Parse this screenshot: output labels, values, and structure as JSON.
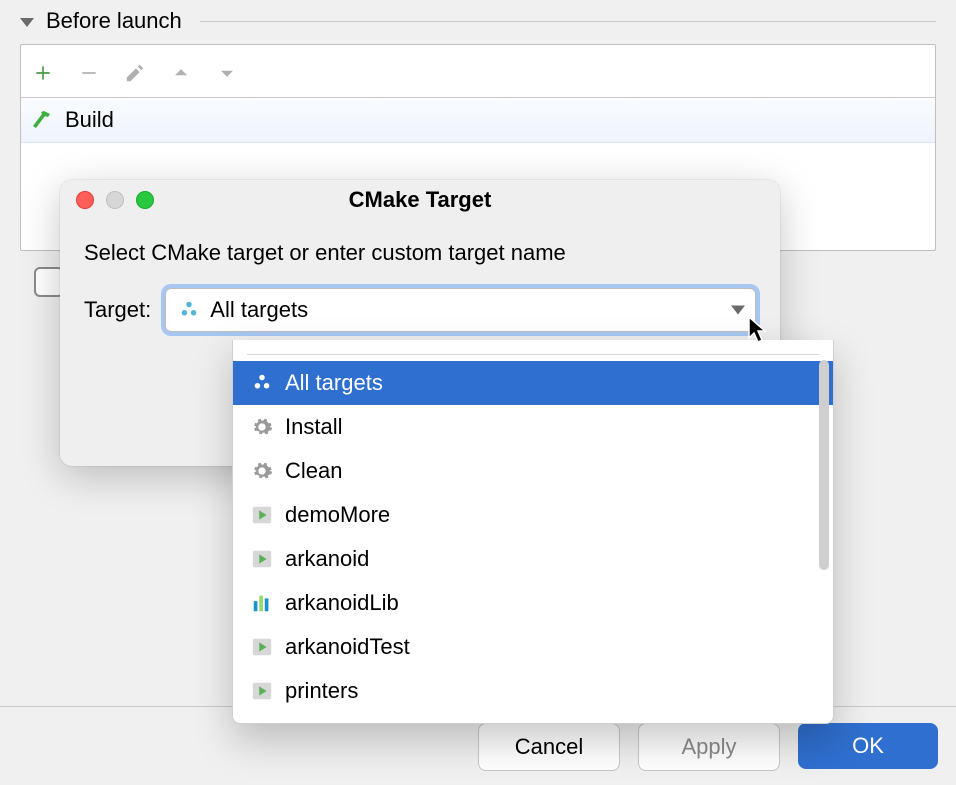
{
  "section": {
    "title": "Before launch"
  },
  "toolbar": {
    "add_tip": "Add",
    "remove_tip": "Remove",
    "edit_tip": "Edit",
    "up_tip": "Move up",
    "down_tip": "Move down"
  },
  "task": {
    "name": "Build"
  },
  "checkbox": {
    "show_page_label": ""
  },
  "popup": {
    "title": "CMake Target",
    "instruction": "Select CMake target or enter custom target name",
    "target_label": "Target:",
    "selected_value": "All targets",
    "selected_icon": "cluster-icon"
  },
  "dropdown": {
    "items": [
      {
        "icon": "cluster-icon",
        "label": "All targets",
        "selected": true
      },
      {
        "icon": "gear-icon",
        "label": "Install"
      },
      {
        "icon": "gear-icon",
        "label": "Clean"
      },
      {
        "icon": "run-box-icon",
        "label": "demoMore"
      },
      {
        "icon": "run-box-icon",
        "label": "arkanoid"
      },
      {
        "icon": "bars-icon",
        "label": "arkanoidLib"
      },
      {
        "icon": "run-box-icon",
        "label": "arkanoidTest"
      },
      {
        "icon": "run-box-icon",
        "label": "printers"
      }
    ]
  },
  "buttons": {
    "cancel": "Cancel",
    "apply": "Apply",
    "ok": "OK"
  }
}
